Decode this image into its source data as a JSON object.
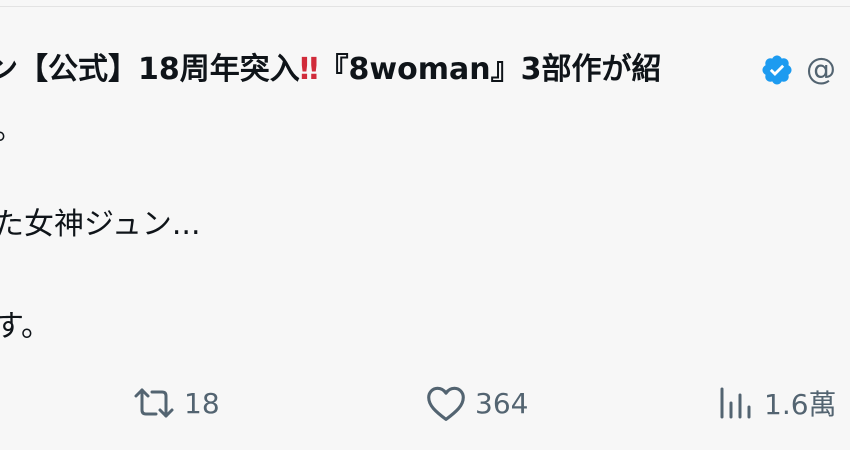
{
  "tweet": {
    "author": {
      "name_prefix": "ン【公式】18周年突入",
      "name_emoji": "‼",
      "name_suffix": "『8woman』3部作が紹",
      "verified": true,
      "handle": "@"
    },
    "body": {
      "line1": "。",
      "line2": "た女神ジュン...",
      "line3": "す。"
    },
    "actions": {
      "retweet_count": "18",
      "like_count": "364",
      "view_count": "1.6萬"
    }
  },
  "colors": {
    "background": "#f7f7f7",
    "text": "#0f1419",
    "muted": "#536471",
    "verified_badge": "#1d9bf0",
    "emoji_red": "#d12b3a"
  },
  "icons": {
    "verified": "verified-badge-icon",
    "retweet": "retweet-icon",
    "like": "heart-icon",
    "views": "views-bar-chart-icon"
  }
}
